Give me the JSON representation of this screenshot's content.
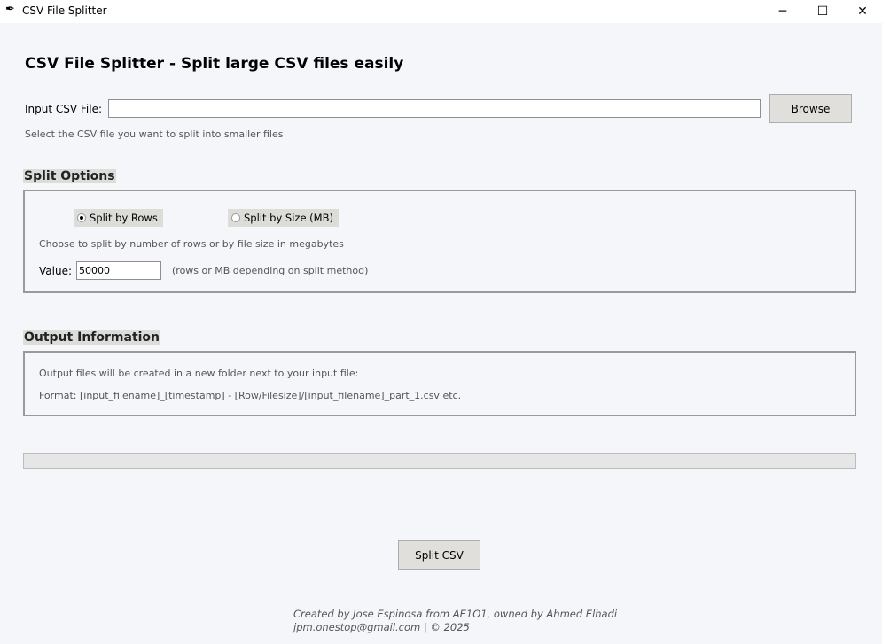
{
  "window": {
    "title": "CSV File Splitter"
  },
  "header": {
    "title": "CSV File Splitter - Split large CSV files easily"
  },
  "input": {
    "label": "Input CSV File:",
    "value": "",
    "browse_label": "Browse",
    "hint": "Select the CSV file you want to split into smaller files"
  },
  "split_options": {
    "title": "Split Options",
    "radio_rows": "Split by Rows",
    "radio_size": "Split by Size (MB)",
    "selected": "rows",
    "hint": "Choose to split by number of rows or by file size in megabytes",
    "value_label": "Value:",
    "value": "50000",
    "value_hint": "(rows or MB depending on split method)"
  },
  "output_info": {
    "title": "Output Information",
    "line1": "Output files will be created in a new folder next to your input file:",
    "line2": "Format: [input_filename]_[timestamp] - [Row/Filesize]/[input_filename]_part_1.csv etc."
  },
  "progress": {
    "value": 0
  },
  "actions": {
    "split_label": "Split CSV"
  },
  "footer": {
    "line1": "Created by Jose Espinosa from AE1O1, owned by Ahmed Elhadi",
    "line2": "jpm.onestop@gmail.com | © 2025"
  }
}
